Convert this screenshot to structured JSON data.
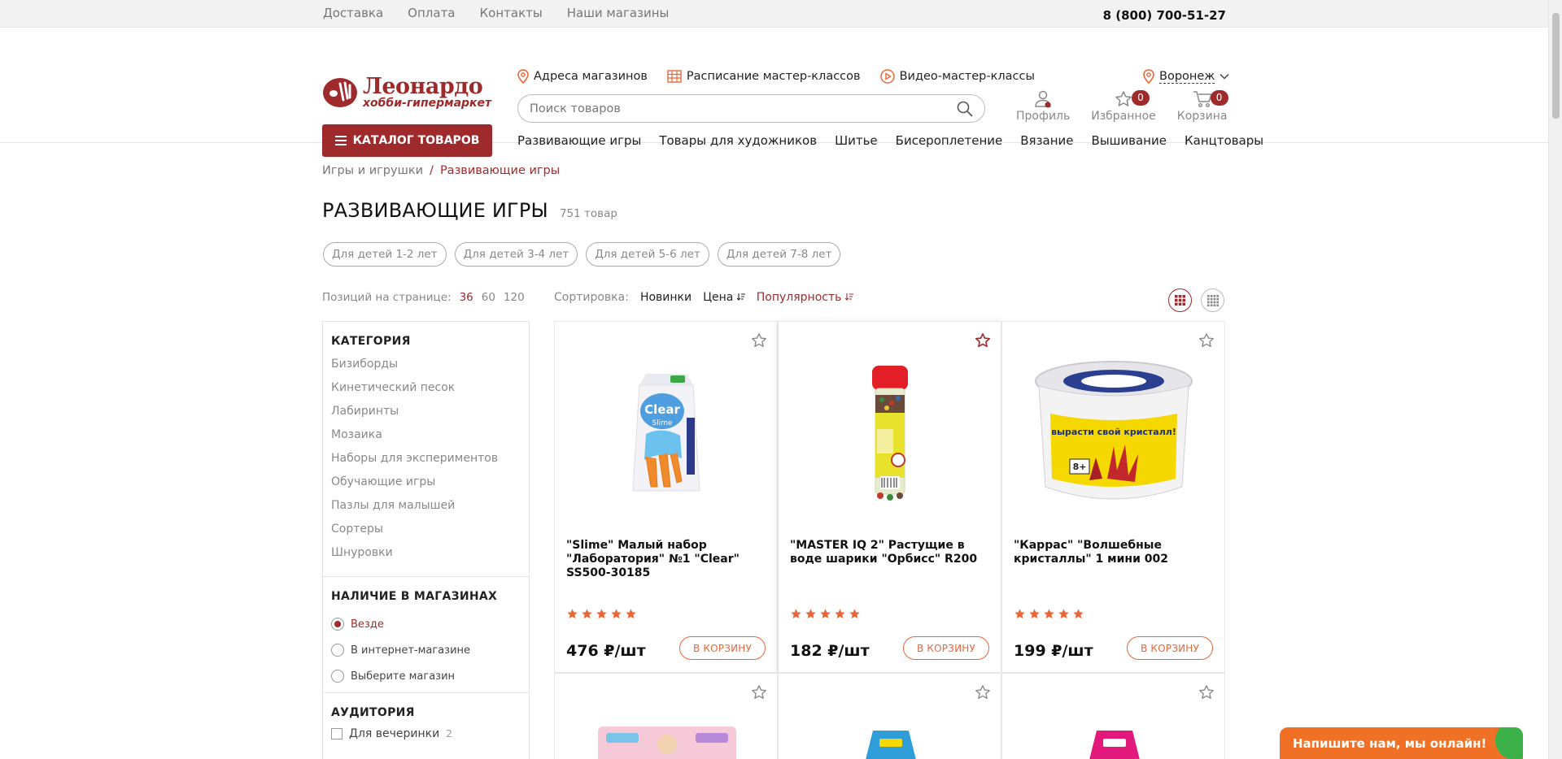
{
  "topbar": {
    "links": [
      "Доставка",
      "Оплата",
      "Контакты",
      "Наши магазины"
    ],
    "phone": "8 (800) 700-51-27"
  },
  "logo": {
    "brand": "Леонардо",
    "sub": "хобби-гипермаркет"
  },
  "infolinks": [
    "Адреса магазинов",
    "Расписание мастер-классов",
    "Видео-мастер-классы"
  ],
  "city": "Воронеж",
  "search": {
    "placeholder": "Поиск товаров"
  },
  "header_icons": {
    "profile": "Профиль",
    "favorites": "Избранное",
    "favorites_count": "0",
    "cart": "Корзина",
    "cart_count": "0"
  },
  "catalog_button": "КАТАЛОГ ТОВАРОВ",
  "mainnav": [
    "Развивающие игры",
    "Товары для художников",
    "Шитье",
    "Бисероплетение",
    "Вязание",
    "Вышивание",
    "Канцтовары"
  ],
  "breadcrumb": {
    "parent": "Игры и игрушки",
    "sep": "/",
    "current": "Развивающие игры"
  },
  "page": {
    "title": "РАЗВИВАЮЩИЕ ИГРЫ",
    "count": "751 товар"
  },
  "chips": [
    "Для детей 1-2 лет",
    "Для детей 3-4 лет",
    "Для детей 5-6 лет",
    "Для детей 7-8 лет"
  ],
  "perpage": {
    "label": "Позиций на странице:",
    "options": [
      "36",
      "60",
      "120"
    ]
  },
  "sorting": {
    "label": "Сортировка:",
    "options": [
      "Новинки",
      "Цена",
      "Популярность"
    ]
  },
  "sidebar": {
    "category_title": "КАТЕГОРИЯ",
    "categories": [
      "Бизиборды",
      "Кинетический песок",
      "Лабиринты",
      "Мозаика",
      "Наборы для экспериментов",
      "Обучающие игры",
      "Пазлы для малышей",
      "Сортеры",
      "Шнуровки"
    ],
    "stock_title": "НАЛИЧИЕ В МАГАЗИНАХ",
    "stock_options": [
      "Везде",
      "В интернет-магазине",
      "Выберите магазин"
    ],
    "audience_title": "АУДИТОРИЯ",
    "audience": {
      "label": "Для вечеринки",
      "count": "2"
    }
  },
  "products": [
    {
      "title": "\"Slime\" Малый набор \"Лаборатория\" №1 \"Clear\" SS500-30185",
      "price": "476 ₽/шт",
      "buy": "В КОРЗИНУ",
      "favorited": false
    },
    {
      "title": "\"MASTER IQ 2\" Растущие в воде шарики \"Орбисс\" R200",
      "price": "182 ₽/шт",
      "buy": "В КОРЗИНУ",
      "favorited": true
    },
    {
      "title": "\"Каррас\" \"Волшебные кристаллы\" 1 мини 002",
      "price": "199 ₽/шт",
      "buy": "В КОРЗИНУ",
      "favorited": false
    }
  ],
  "product_images": {
    "p1": "Slime",
    "p2": "Clear",
    "p3": "вырасти свой кристалл!",
    "p3_age": "8+"
  },
  "chat": "Напишите нам, мы онлайн!",
  "colors": {
    "accent": "#9e2a2b",
    "orange": "#e8673a",
    "chat": "#f07125"
  }
}
